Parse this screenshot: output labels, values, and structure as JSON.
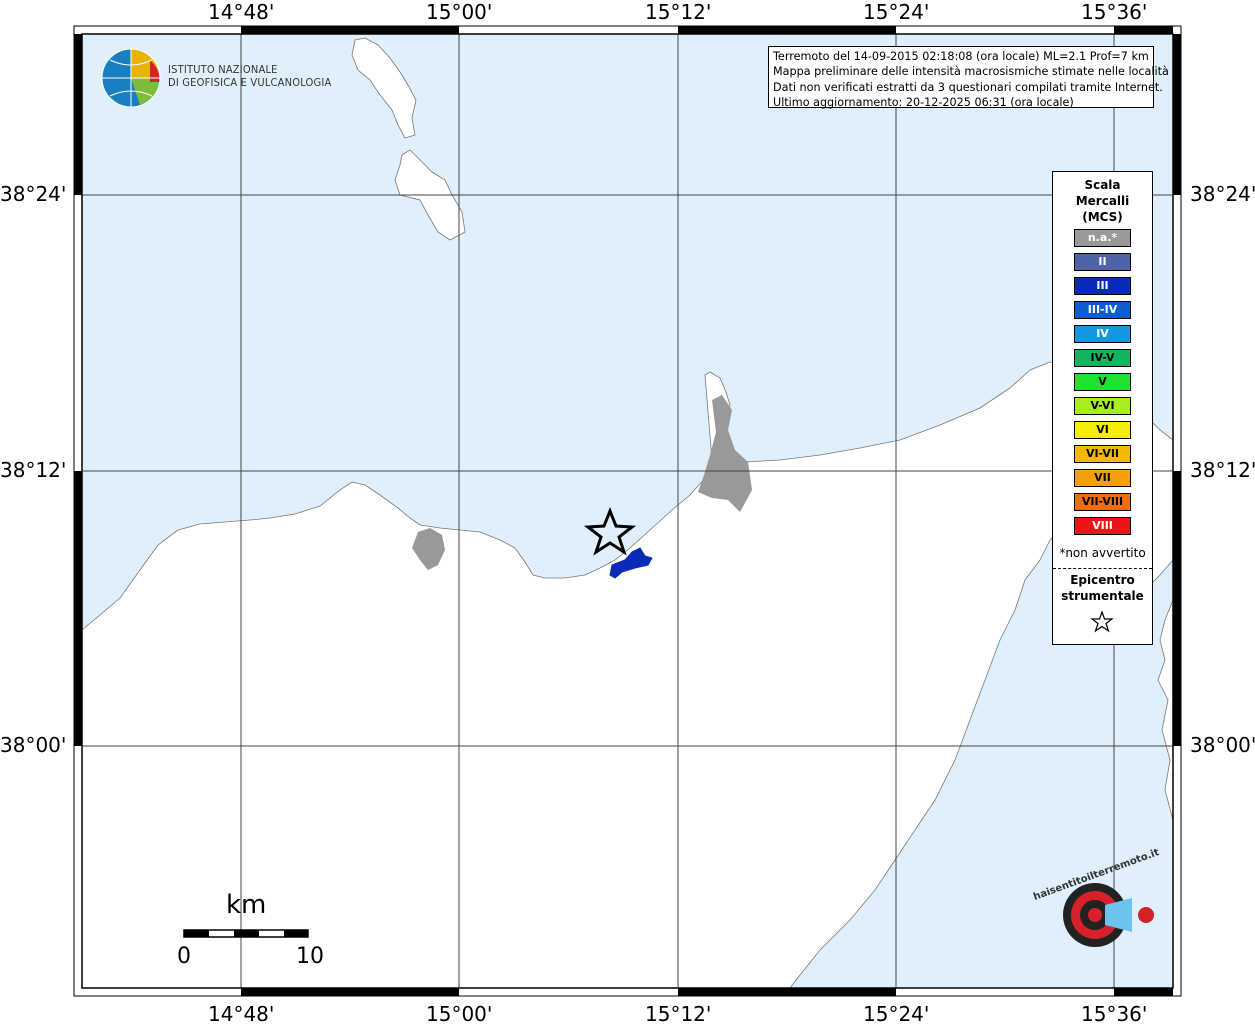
{
  "info": {
    "line1": "Terremoto del 14-09-2015 02:18:08 (ora locale) ML=2.1 Prof=7 km",
    "line2": "Mappa preliminare delle intensità macrosismiche stimate nelle località",
    "line3": "Dati non verificati estratti da 3 questionari compilati tramite Internet.",
    "line4": "Ultimo aggiornamento: 20-12-2025 06:31 (ora locale)"
  },
  "institute": {
    "line1": "ISTITUTO NAZIONALE",
    "line2": "DI GEOFISICA E VULCANOLOGIA"
  },
  "axes": {
    "lon_ticks": [
      "14°48'",
      "15°00'",
      "15°12'",
      "15°24'",
      "15°36'"
    ],
    "lat_ticks": [
      "38°24'",
      "38°12'",
      "38°00'"
    ]
  },
  "legend": {
    "title_line1": "Scala",
    "title_line2": "Mercalli",
    "title_line3": "(MCS)",
    "items": [
      {
        "label": "n.a.*",
        "color": "#999999"
      },
      {
        "label": "II",
        "color": "#4f63a8"
      },
      {
        "label": "III",
        "color": "#0a2bb8"
      },
      {
        "label": "III-IV",
        "color": "#0a5ecf"
      },
      {
        "label": "IV",
        "color": "#1696e0"
      },
      {
        "label": "IV-V",
        "color": "#10b55e"
      },
      {
        "label": "V",
        "color": "#1fe22e"
      },
      {
        "label": "V-VI",
        "color": "#a5ef1e"
      },
      {
        "label": "VI",
        "color": "#f6f000"
      },
      {
        "label": "VI-VII",
        "color": "#f5b800"
      },
      {
        "label": "VII",
        "color": "#f59f0c"
      },
      {
        "label": "VII-VIII",
        "color": "#f26c0b"
      },
      {
        "label": "VIII",
        "color": "#ef1414"
      }
    ],
    "note": "*non avvertito",
    "epicenter_line1": "Epicentro",
    "epicenter_line2": "strumentale"
  },
  "scalebar": {
    "unit": "km",
    "start": "0",
    "end": "10"
  },
  "colors": {
    "sea": "#dff0fc",
    "land": "#ffffff",
    "intensity_marker": "#0a2bb8",
    "not_felt": "#999999"
  },
  "watermark": {
    "text": "haisentitoilterremoto.it"
  }
}
